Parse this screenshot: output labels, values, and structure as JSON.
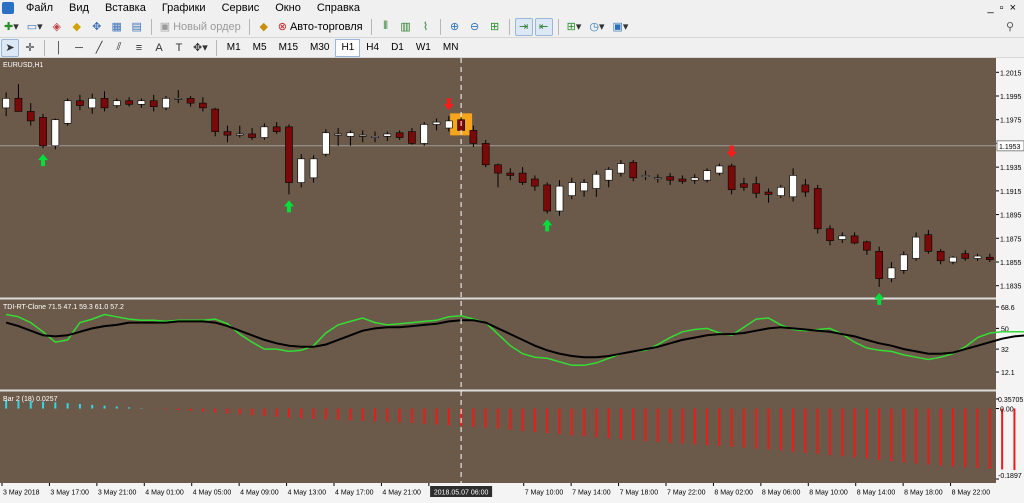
{
  "menu": [
    "Файл",
    "Вид",
    "Вставка",
    "Графики",
    "Сервис",
    "Окно",
    "Справка"
  ],
  "toolbar": {
    "new_order": "Новый ордер",
    "auto_trading": "Авто-торговля",
    "timeframes": [
      "M1",
      "M5",
      "M15",
      "M30",
      "H1",
      "H4",
      "D1",
      "W1",
      "MN"
    ],
    "active_timeframe": "H1"
  },
  "colors": {
    "background": "#6b5a49",
    "bull": "#ffffff",
    "bear": "#7a0a0a",
    "arrow_up": "#00e03a",
    "arrow_down": "#ff1a1a",
    "tdi_fast": "#33dd33",
    "tdi_slow": "#000000",
    "bar_pos": "#33d6e6",
    "bar_neg": "#ee1a1a"
  },
  "chart_data": [
    {
      "type": "candlestick",
      "title": "EURUSD,H1",
      "ylim": [
        1.1828,
        1.2022
      ],
      "y_ticks": [
        "1.2015",
        "1.1995",
        "1.1975",
        "1.1955",
        "1.1935",
        "1.1915",
        "1.1895",
        "1.1875",
        "1.1855",
        "1.1835"
      ],
      "current_price": "1.1953",
      "candles": [
        {
          "o": 1.1985,
          "h": 1.1998,
          "l": 1.1978,
          "c": 1.1993
        },
        {
          "o": 1.1993,
          "h": 1.2005,
          "l": 1.1985,
          "c": 1.1982
        },
        {
          "o": 1.1982,
          "h": 1.1989,
          "l": 1.197,
          "c": 1.1974
        },
        {
          "o": 1.1977,
          "h": 1.198,
          "l": 1.1951,
          "c": 1.1953
        },
        {
          "o": 1.1953,
          "h": 1.1976,
          "l": 1.195,
          "c": 1.1975
        },
        {
          "o": 1.1972,
          "h": 1.1993,
          "l": 1.197,
          "c": 1.1991
        },
        {
          "o": 1.1991,
          "h": 1.1996,
          "l": 1.1983,
          "c": 1.1987
        },
        {
          "o": 1.1985,
          "h": 1.1997,
          "l": 1.198,
          "c": 1.1993
        },
        {
          "o": 1.1993,
          "h": 1.1999,
          "l": 1.1982,
          "c": 1.1985
        },
        {
          "o": 1.1987,
          "h": 1.1993,
          "l": 1.1985,
          "c": 1.1991
        },
        {
          "o": 1.1991,
          "h": 1.1994,
          "l": 1.1986,
          "c": 1.1988
        },
        {
          "o": 1.1988,
          "h": 1.1993,
          "l": 1.1985,
          "c": 1.1991
        },
        {
          "o": 1.1991,
          "h": 1.1996,
          "l": 1.1982,
          "c": 1.1986
        },
        {
          "o": 1.1985,
          "h": 1.1995,
          "l": 1.1983,
          "c": 1.1993
        },
        {
          "o": 1.1993,
          "h": 1.2,
          "l": 1.1989,
          "c": 1.1993
        },
        {
          "o": 1.1993,
          "h": 1.1995,
          "l": 1.1986,
          "c": 1.1989
        },
        {
          "o": 1.1989,
          "h": 1.1994,
          "l": 1.1982,
          "c": 1.1985
        },
        {
          "o": 1.1984,
          "h": 1.1985,
          "l": 1.1961,
          "c": 1.1965
        },
        {
          "o": 1.1965,
          "h": 1.197,
          "l": 1.1956,
          "c": 1.1962
        },
        {
          "o": 1.1962,
          "h": 1.197,
          "l": 1.196,
          "c": 1.1963
        },
        {
          "o": 1.1963,
          "h": 1.1968,
          "l": 1.1958,
          "c": 1.196
        },
        {
          "o": 1.196,
          "h": 1.1972,
          "l": 1.1958,
          "c": 1.1969
        },
        {
          "o": 1.1969,
          "h": 1.1973,
          "l": 1.1963,
          "c": 1.1965
        },
        {
          "o": 1.1969,
          "h": 1.1971,
          "l": 1.1912,
          "c": 1.1922
        },
        {
          "o": 1.1922,
          "h": 1.1946,
          "l": 1.1918,
          "c": 1.1942
        },
        {
          "o": 1.1926,
          "h": 1.1945,
          "l": 1.1922,
          "c": 1.1942
        },
        {
          "o": 1.1946,
          "h": 1.1967,
          "l": 1.1944,
          "c": 1.1964
        },
        {
          "o": 1.1962,
          "h": 1.1968,
          "l": 1.1953,
          "c": 1.1963
        },
        {
          "o": 1.1961,
          "h": 1.1966,
          "l": 1.1953,
          "c": 1.1964
        },
        {
          "o": 1.1961,
          "h": 1.1966,
          "l": 1.1956,
          "c": 1.1962
        },
        {
          "o": 1.196,
          "h": 1.1965,
          "l": 1.1956,
          "c": 1.1961
        },
        {
          "o": 1.1961,
          "h": 1.1965,
          "l": 1.1957,
          "c": 1.1963
        },
        {
          "o": 1.1964,
          "h": 1.1966,
          "l": 1.1958,
          "c": 1.196
        },
        {
          "o": 1.1965,
          "h": 1.1968,
          "l": 1.1954,
          "c": 1.1955
        },
        {
          "o": 1.1955,
          "h": 1.1973,
          "l": 1.1953,
          "c": 1.1971
        },
        {
          "o": 1.1971,
          "h": 1.1976,
          "l": 1.1966,
          "c": 1.1973
        },
        {
          "o": 1.1968,
          "h": 1.1978,
          "l": 1.1965,
          "c": 1.1974
        },
        {
          "o": 1.1975,
          "h": 1.1977,
          "l": 1.1962,
          "c": 1.1966
        },
        {
          "o": 1.1966,
          "h": 1.197,
          "l": 1.1952,
          "c": 1.1955
        },
        {
          "o": 1.1955,
          "h": 1.1958,
          "l": 1.1935,
          "c": 1.1937
        },
        {
          "o": 1.1937,
          "h": 1.1938,
          "l": 1.1918,
          "c": 1.193
        },
        {
          "o": 1.193,
          "h": 1.1934,
          "l": 1.1924,
          "c": 1.1928
        },
        {
          "o": 1.193,
          "h": 1.1935,
          "l": 1.192,
          "c": 1.1922
        },
        {
          "o": 1.1925,
          "h": 1.1928,
          "l": 1.1915,
          "c": 1.1919
        },
        {
          "o": 1.192,
          "h": 1.1922,
          "l": 1.1896,
          "c": 1.1898
        },
        {
          "o": 1.1898,
          "h": 1.1924,
          "l": 1.1894,
          "c": 1.1919
        },
        {
          "o": 1.1911,
          "h": 1.1926,
          "l": 1.1908,
          "c": 1.1922
        },
        {
          "o": 1.1915,
          "h": 1.1925,
          "l": 1.191,
          "c": 1.1922
        },
        {
          "o": 1.1917,
          "h": 1.1932,
          "l": 1.191,
          "c": 1.1929
        },
        {
          "o": 1.1924,
          "h": 1.1935,
          "l": 1.1918,
          "c": 1.1933
        },
        {
          "o": 1.193,
          "h": 1.1941,
          "l": 1.1927,
          "c": 1.1938
        },
        {
          "o": 1.1939,
          "h": 1.1941,
          "l": 1.1923,
          "c": 1.1926
        },
        {
          "o": 1.1927,
          "h": 1.1932,
          "l": 1.1924,
          "c": 1.1928
        },
        {
          "o": 1.1926,
          "h": 1.1929,
          "l": 1.1922,
          "c": 1.1926
        },
        {
          "o": 1.1927,
          "h": 1.193,
          "l": 1.192,
          "c": 1.1924
        },
        {
          "o": 1.1925,
          "h": 1.1928,
          "l": 1.1921,
          "c": 1.1923
        },
        {
          "o": 1.1924,
          "h": 1.1929,
          "l": 1.1921,
          "c": 1.1926
        },
        {
          "o": 1.1924,
          "h": 1.1934,
          "l": 1.1922,
          "c": 1.1932
        },
        {
          "o": 1.193,
          "h": 1.1938,
          "l": 1.1928,
          "c": 1.1936
        },
        {
          "o": 1.1936,
          "h": 1.1938,
          "l": 1.1912,
          "c": 1.1916
        },
        {
          "o": 1.1921,
          "h": 1.1926,
          "l": 1.1915,
          "c": 1.1918
        },
        {
          "o": 1.1921,
          "h": 1.1927,
          "l": 1.1909,
          "c": 1.1913
        },
        {
          "o": 1.1914,
          "h": 1.1917,
          "l": 1.1905,
          "c": 1.1912
        },
        {
          "o": 1.1911,
          "h": 1.192,
          "l": 1.1909,
          "c": 1.1918
        },
        {
          "o": 1.191,
          "h": 1.1934,
          "l": 1.1906,
          "c": 1.1928
        },
        {
          "o": 1.192,
          "h": 1.1925,
          "l": 1.191,
          "c": 1.1914
        },
        {
          "o": 1.1917,
          "h": 1.192,
          "l": 1.1879,
          "c": 1.1883
        },
        {
          "o": 1.1883,
          "h": 1.1886,
          "l": 1.1869,
          "c": 1.1873
        },
        {
          "o": 1.1874,
          "h": 1.188,
          "l": 1.1871,
          "c": 1.1877
        },
        {
          "o": 1.1877,
          "h": 1.188,
          "l": 1.187,
          "c": 1.1871
        },
        {
          "o": 1.1872,
          "h": 1.1873,
          "l": 1.1861,
          "c": 1.1865
        },
        {
          "o": 1.1864,
          "h": 1.1868,
          "l": 1.1834,
          "c": 1.1841
        },
        {
          "o": 1.1841,
          "h": 1.1855,
          "l": 1.1838,
          "c": 1.185
        },
        {
          "o": 1.1848,
          "h": 1.1864,
          "l": 1.1845,
          "c": 1.1861
        },
        {
          "o": 1.1858,
          "h": 1.188,
          "l": 1.1856,
          "c": 1.1876
        },
        {
          "o": 1.1878,
          "h": 1.1882,
          "l": 1.1862,
          "c": 1.1864
        },
        {
          "o": 1.1864,
          "h": 1.1866,
          "l": 1.1853,
          "c": 1.1856
        },
        {
          "o": 1.1855,
          "h": 1.186,
          "l": 1.1853,
          "c": 1.1859
        },
        {
          "o": 1.1862,
          "h": 1.1865,
          "l": 1.1856,
          "c": 1.1858
        },
        {
          "o": 1.1858,
          "h": 1.1862,
          "l": 1.1856,
          "c": 1.186
        },
        {
          "o": 1.1859,
          "h": 1.1862,
          "l": 1.1855,
          "c": 1.1857
        }
      ],
      "arrows_up": [
        3,
        23,
        44,
        71
      ],
      "arrows_down": [
        36,
        59
      ],
      "highlight_index": 37
    },
    {
      "type": "line",
      "title": "TDI-RT-Clone 71.5 47.1 59.3 61.0 57.2",
      "ylim": [
        0,
        72
      ],
      "y_ticks": [
        "68.6",
        "50",
        "32",
        "12.1"
      ],
      "series": [
        {
          "values": [
            62,
            60,
            55,
            47,
            38,
            40,
            55,
            58,
            62,
            60,
            58,
            57,
            57,
            56,
            57,
            57,
            57,
            58,
            54,
            45,
            38,
            32,
            32,
            30,
            31,
            35,
            46,
            53,
            56,
            59,
            55,
            53,
            54,
            55,
            56,
            57,
            60,
            61,
            58,
            55,
            45,
            35,
            28,
            25,
            24,
            21,
            18,
            18,
            20,
            24,
            28,
            30,
            31,
            36,
            42,
            47,
            49,
            50,
            46,
            44,
            51,
            58,
            59,
            53,
            49,
            48,
            49,
            50,
            45,
            38,
            33,
            31,
            30,
            27,
            25,
            23,
            25,
            28,
            34,
            42,
            46,
            47,
            47,
            47,
            46,
            45
          ]
        },
        {
          "values": [
            55,
            52,
            48,
            44,
            43,
            44,
            47,
            50,
            52,
            53,
            55,
            55,
            55,
            55,
            56,
            56,
            56,
            55,
            52,
            48,
            44,
            40,
            37,
            35,
            34,
            34,
            36,
            40,
            44,
            48,
            50,
            51,
            51,
            52,
            53,
            54,
            56,
            57,
            57,
            55,
            50,
            45,
            40,
            35,
            31,
            28,
            26,
            25,
            25,
            26,
            28,
            30,
            32,
            34,
            37,
            40,
            42,
            44,
            45,
            45,
            46,
            48,
            50,
            51,
            50,
            49,
            48,
            47,
            45,
            43,
            40,
            37,
            35,
            32,
            30,
            28,
            28,
            29,
            32,
            35,
            38,
            41,
            43,
            44,
            45,
            45
          ]
        }
      ]
    },
    {
      "type": "bar",
      "title": "Bar 2 (18) 0.0257",
      "ylim": [
        -0.1897,
        0.0257
      ],
      "y_ticks": [
        "0.35705",
        "0.00",
        "-0.1897"
      ],
      "values": [
        0.0229,
        0.0221,
        0.0206,
        0.0187,
        0.0168,
        0.0145,
        0.0122,
        0.0099,
        0.0076,
        0.0053,
        0.0031,
        0.0011,
        -0.0008,
        -0.0025,
        -0.0042,
        -0.0063,
        -0.0086,
        -0.011,
        -0.0134,
        -0.0158,
        -0.018,
        -0.0202,
        -0.0223,
        -0.0243,
        -0.0261,
        -0.0278,
        -0.0293,
        -0.0306,
        -0.0318,
        -0.0329,
        -0.0342,
        -0.0356,
        -0.0373,
        -0.0392,
        -0.0412,
        -0.0432,
        -0.0451,
        -0.047,
        -0.049,
        -0.0515,
        -0.0542,
        -0.0571,
        -0.06,
        -0.0631,
        -0.0662,
        -0.0692,
        -0.0722,
        -0.0751,
        -0.0779,
        -0.0806,
        -0.0831,
        -0.0854,
        -0.0877,
        -0.0899,
        -0.092,
        -0.0941,
        -0.0963,
        -0.0985,
        -0.1008,
        -0.1031,
        -0.1055,
        -0.108,
        -0.1106,
        -0.1133,
        -0.1161,
        -0.1191,
        -0.1221,
        -0.1252,
        -0.1284,
        -0.1317,
        -0.135,
        -0.1383,
        -0.1416,
        -0.1448,
        -0.1478,
        -0.1507,
        -0.1534,
        -0.1559,
        -0.1582,
        -0.1604,
        -0.1623,
        -0.164,
        -0.1655,
        -0.1668,
        -0.1679,
        -0.1687,
        -0.1693,
        -0.1697,
        -0.1699,
        -0.17
      ]
    }
  ],
  "x_ticks": [
    "3 May 2018",
    "3 May 17:00",
    "3 May 21:00",
    "4 May 01:00",
    "4 May 05:00",
    "4 May 09:00",
    "4 May 13:00",
    "4 May 17:00",
    "4 May 21:00",
    "7 May",
    "2018.05.07 06:00",
    "7 May 10:00",
    "7 May 14:00",
    "7 May 18:00",
    "7 May 22:00",
    "8 May 02:00",
    "8 May 06:00",
    "8 May 10:00",
    "8 May 14:00",
    "8 May 18:00",
    "8 May 22:00"
  ]
}
